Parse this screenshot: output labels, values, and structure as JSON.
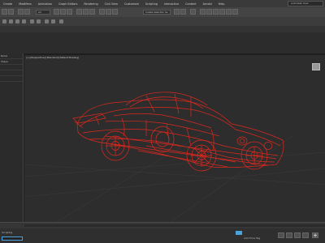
{
  "menubar": {
    "items": [
      "Create",
      "Modifiers",
      "Animation",
      "Graph Editors",
      "Rendering",
      "Civil View",
      "Customize",
      "Scripting",
      "Interactive",
      "Content",
      "Arnold",
      "Help"
    ],
    "user": "Autodesk User",
    "workspace": "Default"
  },
  "toolbar": {
    "filter_value": "All",
    "selection_set": "Create Selection Se"
  },
  "viewport": {
    "label": "[+] [Perspective] [Standard] [Default Shading]",
    "wire_color": "#e0281e"
  },
  "left_panel": {
    "rows": [
      "Name",
      "Shape"
    ]
  },
  "status_bar": {
    "add_time_tag": "Add Time Tag",
    "left_label": "Scripting"
  },
  "colors": {
    "background": "#2d2d2d",
    "ui_dark": "#3a3a3a",
    "accent_blue": "#4aa3df",
    "wireframe": "#e0281e"
  }
}
